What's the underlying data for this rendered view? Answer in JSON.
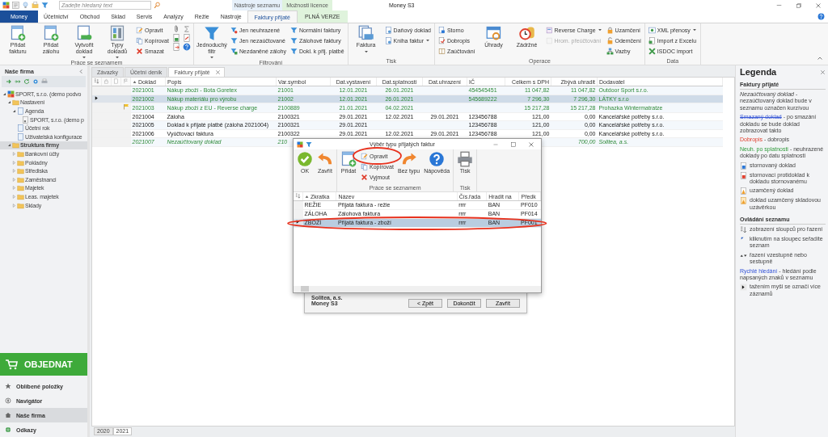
{
  "window": {
    "title": "Money S3",
    "search": {
      "placeholder": "Zadejte hledaný text"
    }
  },
  "context_tabs": [
    {
      "label": "Nástroje seznamu",
      "kind": "list"
    },
    {
      "label": "Možnosti licence",
      "kind": "license"
    }
  ],
  "menu_tabs": [
    {
      "label": "Money",
      "kind": "app",
      "selected": false
    },
    {
      "label": "Účetnictví",
      "kind": "normal",
      "selected": false
    },
    {
      "label": "Obchod",
      "kind": "normal",
      "selected": false
    },
    {
      "label": "Sklad",
      "kind": "normal",
      "selected": false
    },
    {
      "label": "Servis",
      "kind": "normal",
      "selected": false
    },
    {
      "label": "Analýzy",
      "kind": "normal",
      "selected": false
    },
    {
      "label": "Režie",
      "kind": "normal",
      "selected": false
    },
    {
      "label": "Nástroje",
      "kind": "normal",
      "selected": false
    },
    {
      "label": "Faktury přijaté",
      "kind": "list",
      "selected": true
    },
    {
      "label": "PLNÁ VERZE",
      "kind": "license",
      "selected": false
    }
  ],
  "ribbon": [
    {
      "label": "Práce se seznamem",
      "columns": [
        [
          {
            "kind": "large",
            "label": "Přidat fakturu",
            "dropdown": false,
            "disabled": false
          }
        ],
        [
          {
            "kind": "large",
            "label": "Přidat zálohu",
            "dropdown": false,
            "disabled": false
          }
        ],
        [
          {
            "kind": "large",
            "label": "Vytvořit doklad",
            "dropdown": true,
            "disabled": false
          }
        ],
        [
          {
            "kind": "large",
            "label": "Typy dokladů",
            "dropdown": true,
            "disabled": false
          }
        ],
        [
          {
            "kind": "small",
            "label": "Opravit",
            "dropdown": false,
            "disabled": false
          },
          {
            "kind": "small",
            "label": "Kopírovat",
            "dropdown": false,
            "disabled": false
          },
          {
            "kind": "small",
            "label": "Smazat",
            "dropdown": false,
            "disabled": false
          }
        ],
        [
          {
            "kind": "icon",
            "disabled": false
          },
          {
            "kind": "icon",
            "disabled": false
          },
          {
            "kind": "icon",
            "disabled": false
          }
        ],
        [
          {
            "kind": "icon",
            "disabled": false
          },
          {
            "kind": "icon",
            "disabled": false
          },
          {
            "kind": "icon",
            "disabled": false
          }
        ]
      ]
    },
    {
      "label": "Filtrování",
      "columns": [
        [
          {
            "kind": "large",
            "label": "Jednoduchý filtr",
            "dropdown": true,
            "disabled": false
          }
        ],
        [
          {
            "kind": "small",
            "label": "Jen neuhrazené",
            "dropdown": false,
            "disabled": false
          },
          {
            "kind": "small",
            "label": "Jen nezaúčtované",
            "dropdown": false,
            "disabled": false
          },
          {
            "kind": "small",
            "label": "Nezdaněné zálohy",
            "dropdown": false,
            "disabled": false
          }
        ],
        [
          {
            "kind": "small",
            "label": "Normální faktury",
            "dropdown": false,
            "disabled": false
          },
          {
            "kind": "small",
            "label": "Zálohové faktury",
            "dropdown": false,
            "disabled": false
          },
          {
            "kind": "small",
            "label": "Dokl. k přij. platbě",
            "dropdown": false,
            "disabled": false
          }
        ]
      ]
    },
    {
      "label": "Tisk",
      "columns": [
        [
          {
            "kind": "large",
            "label": "Faktura",
            "dropdown": true,
            "disabled": false
          }
        ],
        [
          {
            "kind": "small",
            "label": "Daňový doklad",
            "dropdown": false,
            "disabled": false
          },
          {
            "kind": "small",
            "label": "Kniha faktur",
            "dropdown": true,
            "disabled": false
          }
        ]
      ]
    },
    {
      "label": "Operace",
      "columns": [
        [
          {
            "kind": "small",
            "label": "Storno",
            "dropdown": false,
            "disabled": false
          },
          {
            "kind": "small",
            "label": "Dobropis",
            "dropdown": false,
            "disabled": false
          },
          {
            "kind": "small",
            "label": "Zaúčtování",
            "dropdown": false,
            "disabled": false
          }
        ],
        [
          {
            "kind": "large",
            "label": "Úhrady",
            "dropdown": false,
            "disabled": false
          }
        ],
        [
          {
            "kind": "large",
            "label": "Zádržné",
            "dropdown": false,
            "disabled": false
          }
        ],
        [
          {
            "kind": "small",
            "label": "Reverse Charge",
            "dropdown": true,
            "disabled": false
          },
          {
            "kind": "small",
            "label": "Hrom. přeúčtování",
            "dropdown": false,
            "disabled": true
          }
        ],
        [
          {
            "kind": "small",
            "label": "Uzamčení",
            "dropdown": false,
            "disabled": false
          },
          {
            "kind": "small",
            "label": "Odemčení",
            "dropdown": false,
            "disabled": false
          },
          {
            "kind": "small",
            "label": "Vazby",
            "dropdown": false,
            "disabled": false
          }
        ]
      ]
    },
    {
      "label": "Data",
      "columns": [
        [
          {
            "kind": "small",
            "label": "XML přenosy",
            "dropdown": true,
            "disabled": false
          },
          {
            "kind": "small",
            "label": "Import z Excelu",
            "dropdown": false,
            "disabled": false
          },
          {
            "kind": "small",
            "label": "ISDOC import",
            "dropdown": false,
            "disabled": false
          }
        ]
      ]
    }
  ],
  "sidebar": {
    "title": "Naše firma",
    "tree": [
      {
        "label": "SPORT, s.r.o. (demo podvo",
        "kind": "company",
        "expanded": true,
        "selected": false,
        "children": [
          {
            "label": "Nastavení",
            "kind": "folder",
            "expanded": true,
            "selected": false,
            "children": [
              {
                "label": "Agenda",
                "kind": "page",
                "expanded": true,
                "selected": false,
                "children": [
                  {
                    "label": "SPORT, s.r.o. (demo p",
                    "kind": "subpage",
                    "selected": false
                  }
                ]
              },
              {
                "label": "Účetní rok",
                "kind": "page",
                "selected": false
              },
              {
                "label": "Uživatelská konfigurace",
                "kind": "page",
                "selected": false
              }
            ]
          },
          {
            "label": "Struktura firmy",
            "kind": "folder",
            "expanded": true,
            "selected": true,
            "children": [
              {
                "label": "Bankovní účty",
                "kind": "folder",
                "expanded": false,
                "selected": false
              },
              {
                "label": "Pokladny",
                "kind": "folder",
                "expanded": false,
                "selected": false
              },
              {
                "label": "Střediska",
                "kind": "folder",
                "expanded": false,
                "selected": false
              },
              {
                "label": "Zaměstnanci",
                "kind": "folder",
                "expanded": false,
                "selected": false
              },
              {
                "label": "Majetek",
                "kind": "folder",
                "expanded": false,
                "selected": false
              },
              {
                "label": "Leas. majetek",
                "kind": "folder",
                "expanded": false,
                "selected": false
              },
              {
                "label": "Sklady",
                "kind": "folder",
                "expanded": false,
                "selected": false
              }
            ]
          }
        ]
      }
    ],
    "order_button": "OBJEDNAT",
    "nav": [
      {
        "label": "Oblíbené položky",
        "selected": false
      },
      {
        "label": "Navigátor",
        "selected": false
      },
      {
        "label": "Naše firma",
        "selected": true
      },
      {
        "label": "Odkazy",
        "selected": false
      }
    ]
  },
  "doc_tabs": [
    {
      "label": "Závazky",
      "selected": false,
      "closable": false
    },
    {
      "label": "Účetní deník",
      "selected": false,
      "closable": false
    },
    {
      "label": "Faktury přijaté",
      "selected": true,
      "closable": true
    }
  ],
  "table": {
    "columns": [
      {
        "label": "Doklad",
        "kind": "text",
        "sorted": true
      },
      {
        "label": "Popis",
        "kind": "text",
        "sorted": false
      },
      {
        "label": "Var.symbol",
        "kind": "text",
        "sorted": false
      },
      {
        "label": "Dat.vystavení",
        "kind": "date",
        "sorted": false
      },
      {
        "label": "Dat.splatnosti",
        "kind": "date",
        "sorted": false
      },
      {
        "label": "Dat.uhrazení",
        "kind": "date",
        "sorted": false
      },
      {
        "label": "IČ",
        "kind": "text",
        "sorted": false
      },
      {
        "label": "Celkem s DPH",
        "kind": "amount",
        "sorted": false
      },
      {
        "label": "Zbývá uhradit",
        "kind": "amount",
        "sorted": false
      },
      {
        "label": "Dodavatel",
        "kind": "text",
        "sorted": false
      }
    ],
    "rows": [
      {
        "kind": "overdue",
        "selected": false,
        "flag": false,
        "cells": [
          "2021001",
          "Nákup zboží - Bota Goretex",
          "21001",
          "12.01.2021",
          "26.01.2021",
          "",
          "454545451",
          "11 047,82",
          "11 047,82",
          "Outdoor Sport s.r.o."
        ]
      },
      {
        "kind": "overdue",
        "selected": true,
        "flag": false,
        "cells": [
          "2021002",
          "Nákup materiálu pro výrobu",
          "21002",
          "12.01.2021",
          "26.01.2021",
          "",
          "545689222",
          "7 296,30",
          "7 296,30",
          "LÁTKY s.r.o"
        ]
      },
      {
        "kind": "overdue",
        "selected": false,
        "flag": true,
        "cells": [
          "2021003",
          "Nákup zboží z EU - Reverse charge",
          "2100889",
          "21.01.2021",
          "04.02.2021",
          "",
          "",
          "15 217,28",
          "15 217,28",
          "Prohazka Wintermatratze"
        ]
      },
      {
        "kind": "normal",
        "selected": false,
        "flag": false,
        "cells": [
          "2021004",
          "Záloha",
          "2100321",
          "29.01.2021",
          "12.02.2021",
          "29.01.2021",
          "123456788",
          "121,00",
          "0,00",
          "Kancelářské potřeby s.r.o."
        ]
      },
      {
        "kind": "normal",
        "selected": false,
        "flag": false,
        "cells": [
          "2021005",
          "Doklad k přijaté platbě (záloha 2021004)",
          "2100321",
          "29.01.2021",
          "",
          "",
          "123456788",
          "121,00",
          "0,00",
          "Kancelářské potřeby s.r.o."
        ]
      },
      {
        "kind": "normal",
        "selected": false,
        "flag": false,
        "cells": [
          "2021006",
          "Vyúčtovací faktura",
          "2100322",
          "29.01.2021",
          "12.02.2021",
          "29.01.2021",
          "123456788",
          "121,00",
          "0,00",
          "Kancelářské potřeby s.r.o."
        ]
      },
      {
        "kind": "unposted",
        "selected": false,
        "flag": false,
        "cells": [
          "2021007",
          "Nezaúčtovaný doklad",
          "210",
          "",
          "",
          "",
          "",
          "",
          "700,00",
          "Solitea, a.s."
        ]
      }
    ]
  },
  "sheet_tabs": [
    {
      "label": "2020",
      "selected": false
    },
    {
      "label": "2021",
      "selected": true
    }
  ],
  "wizard": {
    "company": "Solitea, a.s.",
    "product": "Money S3",
    "buttons": [
      "< Zpět",
      "Dokončit",
      "Zavřít"
    ]
  },
  "dialog": {
    "title": "Výběr typu přijatých faktur",
    "toolbar": [
      {
        "columns": [
          [
            {
              "kind": "large",
              "label": "OK"
            }
          ],
          [
            {
              "kind": "large",
              "label": "Zavřít"
            }
          ]
        ]
      },
      {
        "label": "Práce se seznamem",
        "columns": [
          [
            {
              "kind": "large",
              "label": "Přidat"
            }
          ],
          [
            {
              "kind": "small",
              "label": "Opravit"
            },
            {
              "kind": "small",
              "label": "Kopírovat"
            },
            {
              "kind": "small",
              "label": "Vyjmout"
            }
          ],
          [
            {
              "kind": "large",
              "label": "Bez typu"
            }
          ],
          [
            {
              "kind": "large",
              "label": "Nápověda"
            }
          ]
        ]
      },
      {
        "label": "Tisk",
        "columns": [
          [
            {
              "kind": "large",
              "label": "Tisk"
            }
          ]
        ]
      }
    ],
    "columns": [
      {
        "label": "Zkratka",
        "sorted": true
      },
      {
        "label": "Název",
        "sorted": false
      },
      {
        "label": "Čís.řada",
        "sorted": false
      },
      {
        "label": "Hradit na",
        "sorted": false
      },
      {
        "label": "Předk",
        "sorted": false
      }
    ],
    "rows": [
      {
        "selected": false,
        "cells": [
          "REŽIE",
          "Přijatá faktura - režie",
          "rrrr",
          "BAN",
          "PF010"
        ]
      },
      {
        "selected": false,
        "cells": [
          "ZÁLOHA",
          "Zálohová faktura",
          "rrrr",
          "BAN",
          "PF014"
        ]
      },
      {
        "selected": true,
        "cells": [
          "ZBOŽÍ",
          "Přijatá faktura - zboží",
          "rrrr",
          "BAN",
          "PF001"
        ]
      }
    ]
  },
  "legend": {
    "title": "Legenda",
    "sections": [
      {
        "title": "Faktury přijaté",
        "items": [
          {
            "kind": "italic",
            "term": "Nezaúčtovaný doklad",
            "text": " - nezaúčtovaný doklad bude v seznamu označen kurzívou"
          },
          {
            "kind": "deleted",
            "term": "Smazaný doklad",
            "text": " - po smazání dokladu se bude doklad zobrazovat takto"
          },
          {
            "kind": "credit",
            "term": "Dobropis",
            "text": " - dobropis"
          },
          {
            "kind": "overdue",
            "term": "Neuh. po splatnosti",
            "text": " - neuhrazené doklady po datu splatnosti"
          },
          {
            "kind": "storno",
            "text": "stornovaný doklad"
          },
          {
            "kind": "counter",
            "text": "stornovací protidoklad k dokladu stornovanému"
          },
          {
            "kind": "locked",
            "text": "uzamčený doklad"
          },
          {
            "kind": "stocklock",
            "text": "doklad uzamčený skladovou uzávěrkou"
          }
        ]
      },
      {
        "title": "Ovládání seznamu",
        "items": [
          {
            "kind": "columns",
            "text": "zobrazení sloupců pro řazení"
          },
          {
            "kind": "corner",
            "text": "kliknutím na sloupec seřadíte seznam"
          },
          {
            "kind": "arrows",
            "text": "řazení vzestupně nebo sestupně"
          },
          {
            "kind": "search",
            "term": "Rychlé hledání",
            "text": " - hledání podle napsaných znaků v seznamu"
          },
          {
            "kind": "pointer",
            "text": "tažením myši se označí více záznamů"
          }
        ]
      }
    ]
  }
}
